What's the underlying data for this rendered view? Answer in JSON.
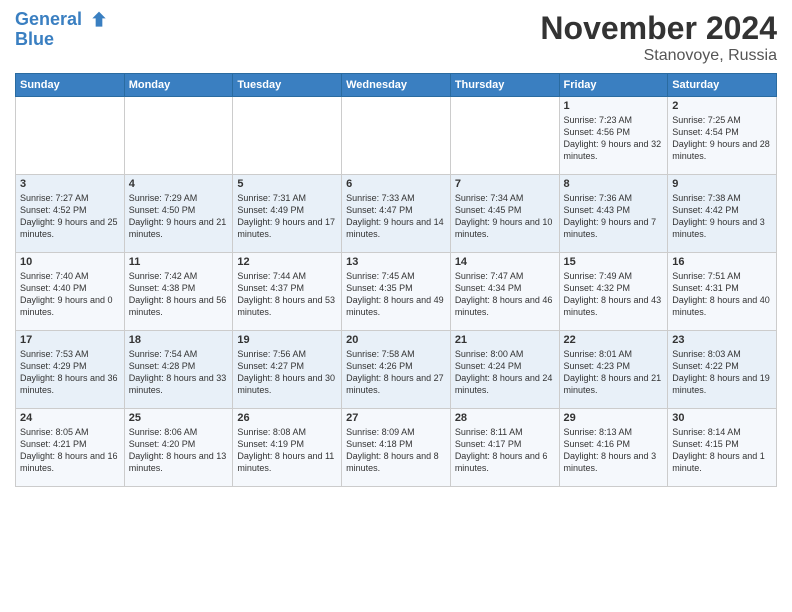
{
  "header": {
    "logo_line1": "General",
    "logo_line2": "Blue",
    "month": "November 2024",
    "location": "Stanovoye, Russia"
  },
  "days_of_week": [
    "Sunday",
    "Monday",
    "Tuesday",
    "Wednesday",
    "Thursday",
    "Friday",
    "Saturday"
  ],
  "weeks": [
    [
      {
        "num": "",
        "sunrise": "",
        "sunset": "",
        "daylight": ""
      },
      {
        "num": "",
        "sunrise": "",
        "sunset": "",
        "daylight": ""
      },
      {
        "num": "",
        "sunrise": "",
        "sunset": "",
        "daylight": ""
      },
      {
        "num": "",
        "sunrise": "",
        "sunset": "",
        "daylight": ""
      },
      {
        "num": "",
        "sunrise": "",
        "sunset": "",
        "daylight": ""
      },
      {
        "num": "1",
        "sunrise": "Sunrise: 7:23 AM",
        "sunset": "Sunset: 4:56 PM",
        "daylight": "Daylight: 9 hours and 32 minutes."
      },
      {
        "num": "2",
        "sunrise": "Sunrise: 7:25 AM",
        "sunset": "Sunset: 4:54 PM",
        "daylight": "Daylight: 9 hours and 28 minutes."
      }
    ],
    [
      {
        "num": "3",
        "sunrise": "Sunrise: 7:27 AM",
        "sunset": "Sunset: 4:52 PM",
        "daylight": "Daylight: 9 hours and 25 minutes."
      },
      {
        "num": "4",
        "sunrise": "Sunrise: 7:29 AM",
        "sunset": "Sunset: 4:50 PM",
        "daylight": "Daylight: 9 hours and 21 minutes."
      },
      {
        "num": "5",
        "sunrise": "Sunrise: 7:31 AM",
        "sunset": "Sunset: 4:49 PM",
        "daylight": "Daylight: 9 hours and 17 minutes."
      },
      {
        "num": "6",
        "sunrise": "Sunrise: 7:33 AM",
        "sunset": "Sunset: 4:47 PM",
        "daylight": "Daylight: 9 hours and 14 minutes."
      },
      {
        "num": "7",
        "sunrise": "Sunrise: 7:34 AM",
        "sunset": "Sunset: 4:45 PM",
        "daylight": "Daylight: 9 hours and 10 minutes."
      },
      {
        "num": "8",
        "sunrise": "Sunrise: 7:36 AM",
        "sunset": "Sunset: 4:43 PM",
        "daylight": "Daylight: 9 hours and 7 minutes."
      },
      {
        "num": "9",
        "sunrise": "Sunrise: 7:38 AM",
        "sunset": "Sunset: 4:42 PM",
        "daylight": "Daylight: 9 hours and 3 minutes."
      }
    ],
    [
      {
        "num": "10",
        "sunrise": "Sunrise: 7:40 AM",
        "sunset": "Sunset: 4:40 PM",
        "daylight": "Daylight: 9 hours and 0 minutes."
      },
      {
        "num": "11",
        "sunrise": "Sunrise: 7:42 AM",
        "sunset": "Sunset: 4:38 PM",
        "daylight": "Daylight: 8 hours and 56 minutes."
      },
      {
        "num": "12",
        "sunrise": "Sunrise: 7:44 AM",
        "sunset": "Sunset: 4:37 PM",
        "daylight": "Daylight: 8 hours and 53 minutes."
      },
      {
        "num": "13",
        "sunrise": "Sunrise: 7:45 AM",
        "sunset": "Sunset: 4:35 PM",
        "daylight": "Daylight: 8 hours and 49 minutes."
      },
      {
        "num": "14",
        "sunrise": "Sunrise: 7:47 AM",
        "sunset": "Sunset: 4:34 PM",
        "daylight": "Daylight: 8 hours and 46 minutes."
      },
      {
        "num": "15",
        "sunrise": "Sunrise: 7:49 AM",
        "sunset": "Sunset: 4:32 PM",
        "daylight": "Daylight: 8 hours and 43 minutes."
      },
      {
        "num": "16",
        "sunrise": "Sunrise: 7:51 AM",
        "sunset": "Sunset: 4:31 PM",
        "daylight": "Daylight: 8 hours and 40 minutes."
      }
    ],
    [
      {
        "num": "17",
        "sunrise": "Sunrise: 7:53 AM",
        "sunset": "Sunset: 4:29 PM",
        "daylight": "Daylight: 8 hours and 36 minutes."
      },
      {
        "num": "18",
        "sunrise": "Sunrise: 7:54 AM",
        "sunset": "Sunset: 4:28 PM",
        "daylight": "Daylight: 8 hours and 33 minutes."
      },
      {
        "num": "19",
        "sunrise": "Sunrise: 7:56 AM",
        "sunset": "Sunset: 4:27 PM",
        "daylight": "Daylight: 8 hours and 30 minutes."
      },
      {
        "num": "20",
        "sunrise": "Sunrise: 7:58 AM",
        "sunset": "Sunset: 4:26 PM",
        "daylight": "Daylight: 8 hours and 27 minutes."
      },
      {
        "num": "21",
        "sunrise": "Sunrise: 8:00 AM",
        "sunset": "Sunset: 4:24 PM",
        "daylight": "Daylight: 8 hours and 24 minutes."
      },
      {
        "num": "22",
        "sunrise": "Sunrise: 8:01 AM",
        "sunset": "Sunset: 4:23 PM",
        "daylight": "Daylight: 8 hours and 21 minutes."
      },
      {
        "num": "23",
        "sunrise": "Sunrise: 8:03 AM",
        "sunset": "Sunset: 4:22 PM",
        "daylight": "Daylight: 8 hours and 19 minutes."
      }
    ],
    [
      {
        "num": "24",
        "sunrise": "Sunrise: 8:05 AM",
        "sunset": "Sunset: 4:21 PM",
        "daylight": "Daylight: 8 hours and 16 minutes."
      },
      {
        "num": "25",
        "sunrise": "Sunrise: 8:06 AM",
        "sunset": "Sunset: 4:20 PM",
        "daylight": "Daylight: 8 hours and 13 minutes."
      },
      {
        "num": "26",
        "sunrise": "Sunrise: 8:08 AM",
        "sunset": "Sunset: 4:19 PM",
        "daylight": "Daylight: 8 hours and 11 minutes."
      },
      {
        "num": "27",
        "sunrise": "Sunrise: 8:09 AM",
        "sunset": "Sunset: 4:18 PM",
        "daylight": "Daylight: 8 hours and 8 minutes."
      },
      {
        "num": "28",
        "sunrise": "Sunrise: 8:11 AM",
        "sunset": "Sunset: 4:17 PM",
        "daylight": "Daylight: 8 hours and 6 minutes."
      },
      {
        "num": "29",
        "sunrise": "Sunrise: 8:13 AM",
        "sunset": "Sunset: 4:16 PM",
        "daylight": "Daylight: 8 hours and 3 minutes."
      },
      {
        "num": "30",
        "sunrise": "Sunrise: 8:14 AM",
        "sunset": "Sunset: 4:15 PM",
        "daylight": "Daylight: 8 hours and 1 minute."
      }
    ]
  ]
}
